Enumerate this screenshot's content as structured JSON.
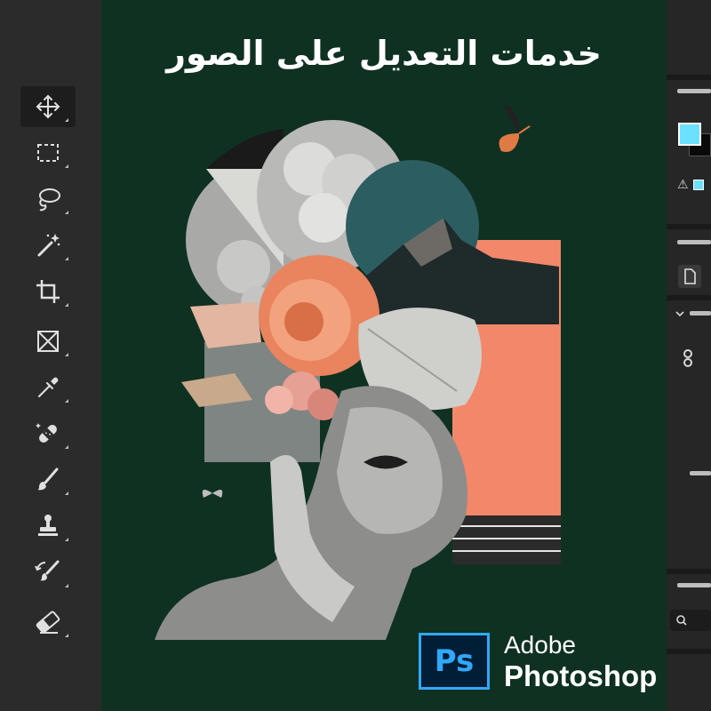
{
  "headline": "خدمات التعديل على الصور",
  "brand": {
    "line1": "Adobe",
    "line2": "Photoshop",
    "logo_text": "Ps"
  },
  "colors": {
    "canvas_bg": "#0f3122",
    "accent_blue": "#31a8ff",
    "swatch_fg": "#6be0ff",
    "coral": "#f2876a"
  },
  "toolbar": {
    "tools": [
      {
        "name": "move-tool",
        "icon": "move-icon",
        "active": true
      },
      {
        "name": "marquee-tool",
        "icon": "rectangular-marquee-icon"
      },
      {
        "name": "lasso-tool",
        "icon": "lasso-icon"
      },
      {
        "name": "magic-wand-tool",
        "icon": "magic-wand-icon"
      },
      {
        "name": "crop-tool",
        "icon": "crop-icon"
      },
      {
        "name": "frame-tool",
        "icon": "frame-icon"
      },
      {
        "name": "eyedropper-tool",
        "icon": "eyedropper-icon"
      },
      {
        "name": "healing-tool",
        "icon": "bandage-icon"
      },
      {
        "name": "brush-tool",
        "icon": "brush-icon"
      },
      {
        "name": "stamp-tool",
        "icon": "clone-stamp-icon"
      },
      {
        "name": "history-brush-tool",
        "icon": "history-brush-icon"
      },
      {
        "name": "eraser-tool",
        "icon": "eraser-icon"
      }
    ]
  },
  "right_panel": {
    "icons": [
      "warning-icon",
      "document-icon",
      "chevron-down-icon",
      "link-icon",
      "search-icon"
    ]
  }
}
